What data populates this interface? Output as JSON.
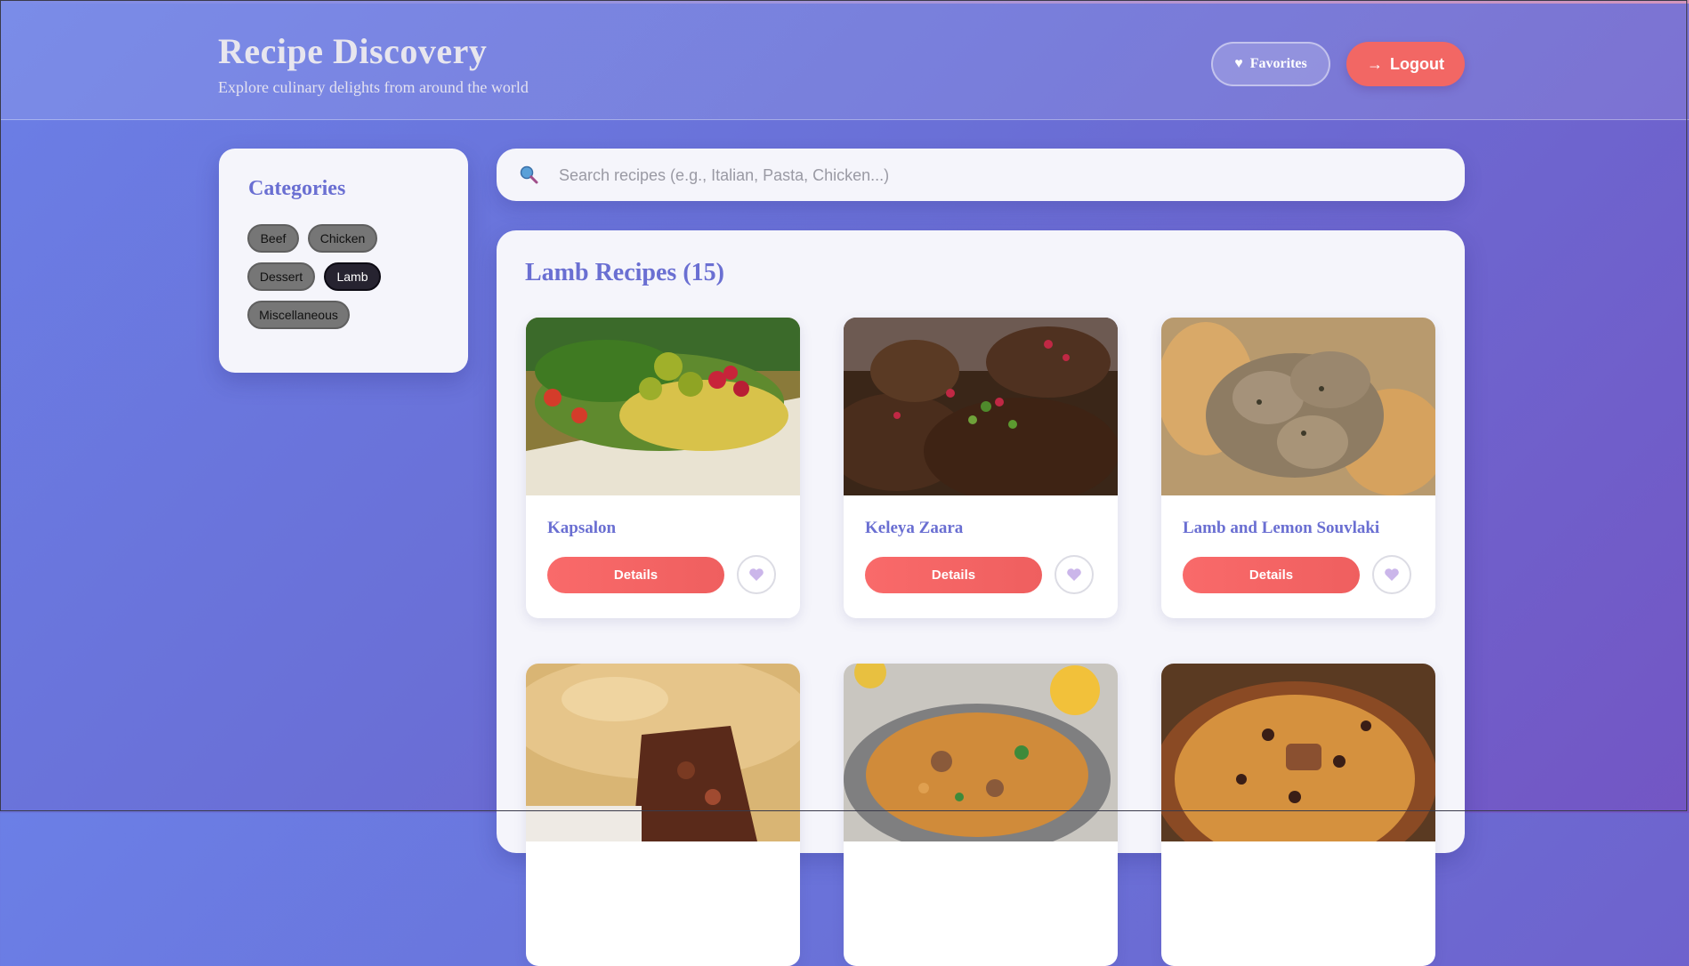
{
  "header": {
    "title": "Recipe Discovery",
    "subtitle": "Explore culinary delights from around the world",
    "favorites_label": "Favorites",
    "favorites_icon": "♥",
    "logout_label": "Logout",
    "logout_icon": "→"
  },
  "sidebar": {
    "title": "Categories",
    "categories": [
      {
        "label": "Beef",
        "active": false
      },
      {
        "label": "Chicken",
        "active": false
      },
      {
        "label": "Dessert",
        "active": false
      },
      {
        "label": "Lamb",
        "active": true
      },
      {
        "label": "Miscellaneous",
        "active": false
      }
    ]
  },
  "search": {
    "placeholder": "Search recipes (e.g., Italian, Pasta, Chicken...)",
    "value": ""
  },
  "main": {
    "title": "Lamb Recipes (15)",
    "details_label": "Details",
    "recipes": [
      {
        "name": "Kapsalon"
      },
      {
        "name": "Keleya Zaara"
      },
      {
        "name": "Lamb and Lemon Souvlaki"
      },
      {
        "name": ""
      },
      {
        "name": ""
      },
      {
        "name": ""
      }
    ]
  },
  "colors": {
    "accent": "#6a6fd2",
    "button": "#f26764",
    "active_chip": "#262330"
  }
}
